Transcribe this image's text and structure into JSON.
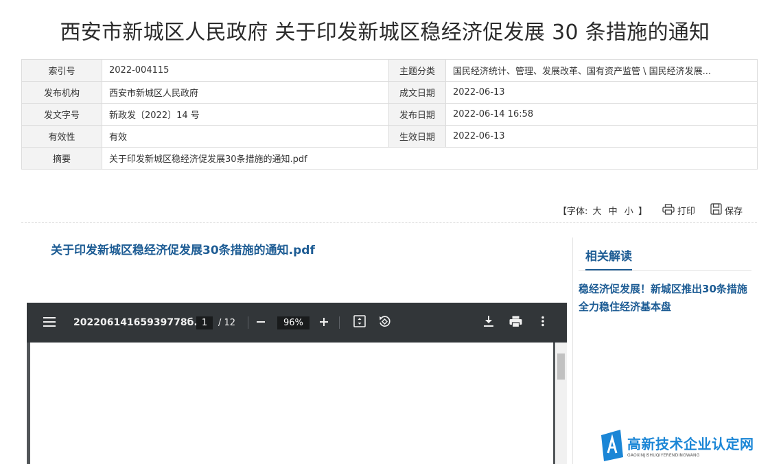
{
  "page_title": "西安市新城区人民政府 关于印发新城区稳经济促发展 30 条措施的通知",
  "meta_rows": [
    {
      "k1": "索引号",
      "v1": "2022-004115",
      "k2": "主题分类",
      "v2": "国民经济统计、管理、发展改革、国有资产监管 \\ 国民经济发展..."
    },
    {
      "k1": "发布机构",
      "v1": "西安市新城区人民政府",
      "k2": "成文日期",
      "v2": "2022-06-13"
    },
    {
      "k1": "发文字号",
      "v1": "新政发〔2022〕14 号",
      "k2": "发布日期",
      "v2": "2022-06-14 16:58"
    },
    {
      "k1": "有效性",
      "v1": "有效",
      "k2": "生效日期",
      "v2": "2022-06-13"
    }
  ],
  "summary_row": {
    "k": "摘要",
    "v": "关于印发新城区稳经济促发展30条措施的通知.pdf"
  },
  "toolbar": {
    "font_prefix": "【字体:",
    "size_large": "大",
    "size_medium": "中",
    "size_small": "小",
    "font_suffix": "】",
    "print_label": "打印",
    "save_label": "保存"
  },
  "doc_title": "关于印发新城区稳经济促发展30条措施的通知.pdf",
  "pdf_viewer": {
    "filename": "20220614165939778б...",
    "current_page": "1",
    "total_pages": "/ 12",
    "zoom": "96%"
  },
  "sidebar": {
    "heading": "相关解读",
    "link": "稳经济促发展！新城区推出30条措施 全力稳住经济基本盘"
  },
  "watermark": {
    "main": "高新技术企业认定网",
    "sub": "GAOXINJISHUQIYERENDINGWANG"
  },
  "colors": {
    "accent": "#1d5c94",
    "viewer_bar": "#323639",
    "watermark": "#1b86d6"
  }
}
